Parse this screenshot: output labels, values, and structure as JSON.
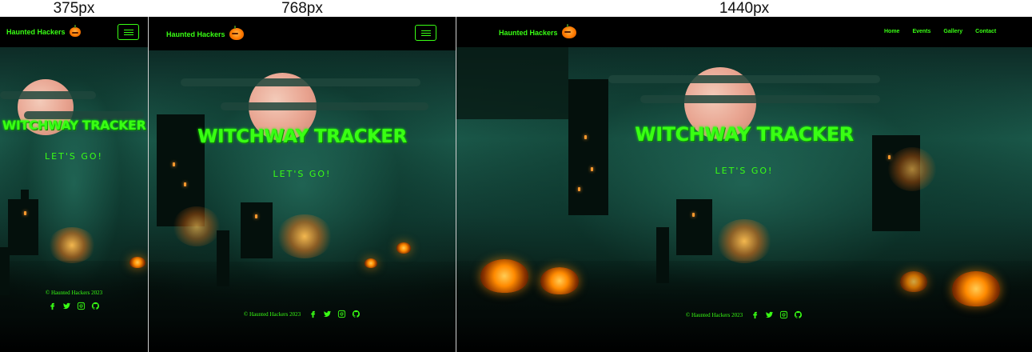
{
  "labels": {
    "mobile": "375px",
    "tablet": "768px",
    "desktop": "1440px"
  },
  "brand": {
    "name": "Haunted Hackers",
    "logo_icon": "pumpkin-icon"
  },
  "nav": {
    "links": [
      "Home",
      "Events",
      "Gallery",
      "Contact"
    ],
    "toggle_icon": "hamburger-menu-icon"
  },
  "hero": {
    "title": "WITCHWAY TRACKER",
    "cta": "LET'S GO!"
  },
  "footer": {
    "copyright": "© Haunted Hackers 2023",
    "social_icons": [
      "facebook-icon",
      "twitter-icon",
      "instagram-icon",
      "github-icon"
    ]
  },
  "colors": {
    "accent": "#39ff14",
    "background": "#000000"
  }
}
